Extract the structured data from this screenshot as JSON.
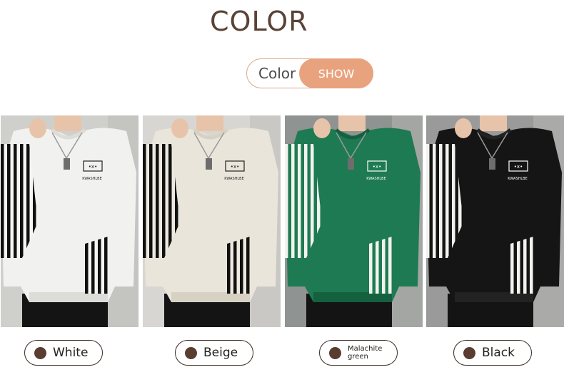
{
  "header": {
    "title": "COLOR"
  },
  "toggle": {
    "color_label": "Color",
    "show_label": "SHOW"
  },
  "variants": [
    {
      "name": "White",
      "shirt": "#f1f1ef",
      "shirt_shade": "#dcdcd8",
      "stripe_bg": "#f5f5f2",
      "stripe": "#111111",
      "logo": "#222222",
      "bg": "#cfcfcb"
    },
    {
      "name": "Beige",
      "shirt": "#e9e5da",
      "shirt_shade": "#d6d1c3",
      "stripe_bg": "#ede9df",
      "stripe": "#111111",
      "logo": "#222222",
      "bg": "#d8d6d2"
    },
    {
      "name": "Malachite green",
      "shirt": "#1e7a52",
      "shirt_shade": "#15603f",
      "stripe_bg": "#1e7a52",
      "stripe": "#f2f2ee",
      "logo": "#ffffff",
      "bg": "#8f9391"
    },
    {
      "name": "Black",
      "shirt": "#151515",
      "shirt_shade": "#222222",
      "stripe_bg": "#151515",
      "stripe": "#f2f2ee",
      "logo": "#ffffff",
      "bg": "#9a9a9a"
    }
  ],
  "logo_text": "KWASHLBE",
  "accent_colors": {
    "title": "#5a4236",
    "pill_border": "#d9a88a",
    "pill_fill": "#e8a37e",
    "dot": "#5a3c30"
  }
}
